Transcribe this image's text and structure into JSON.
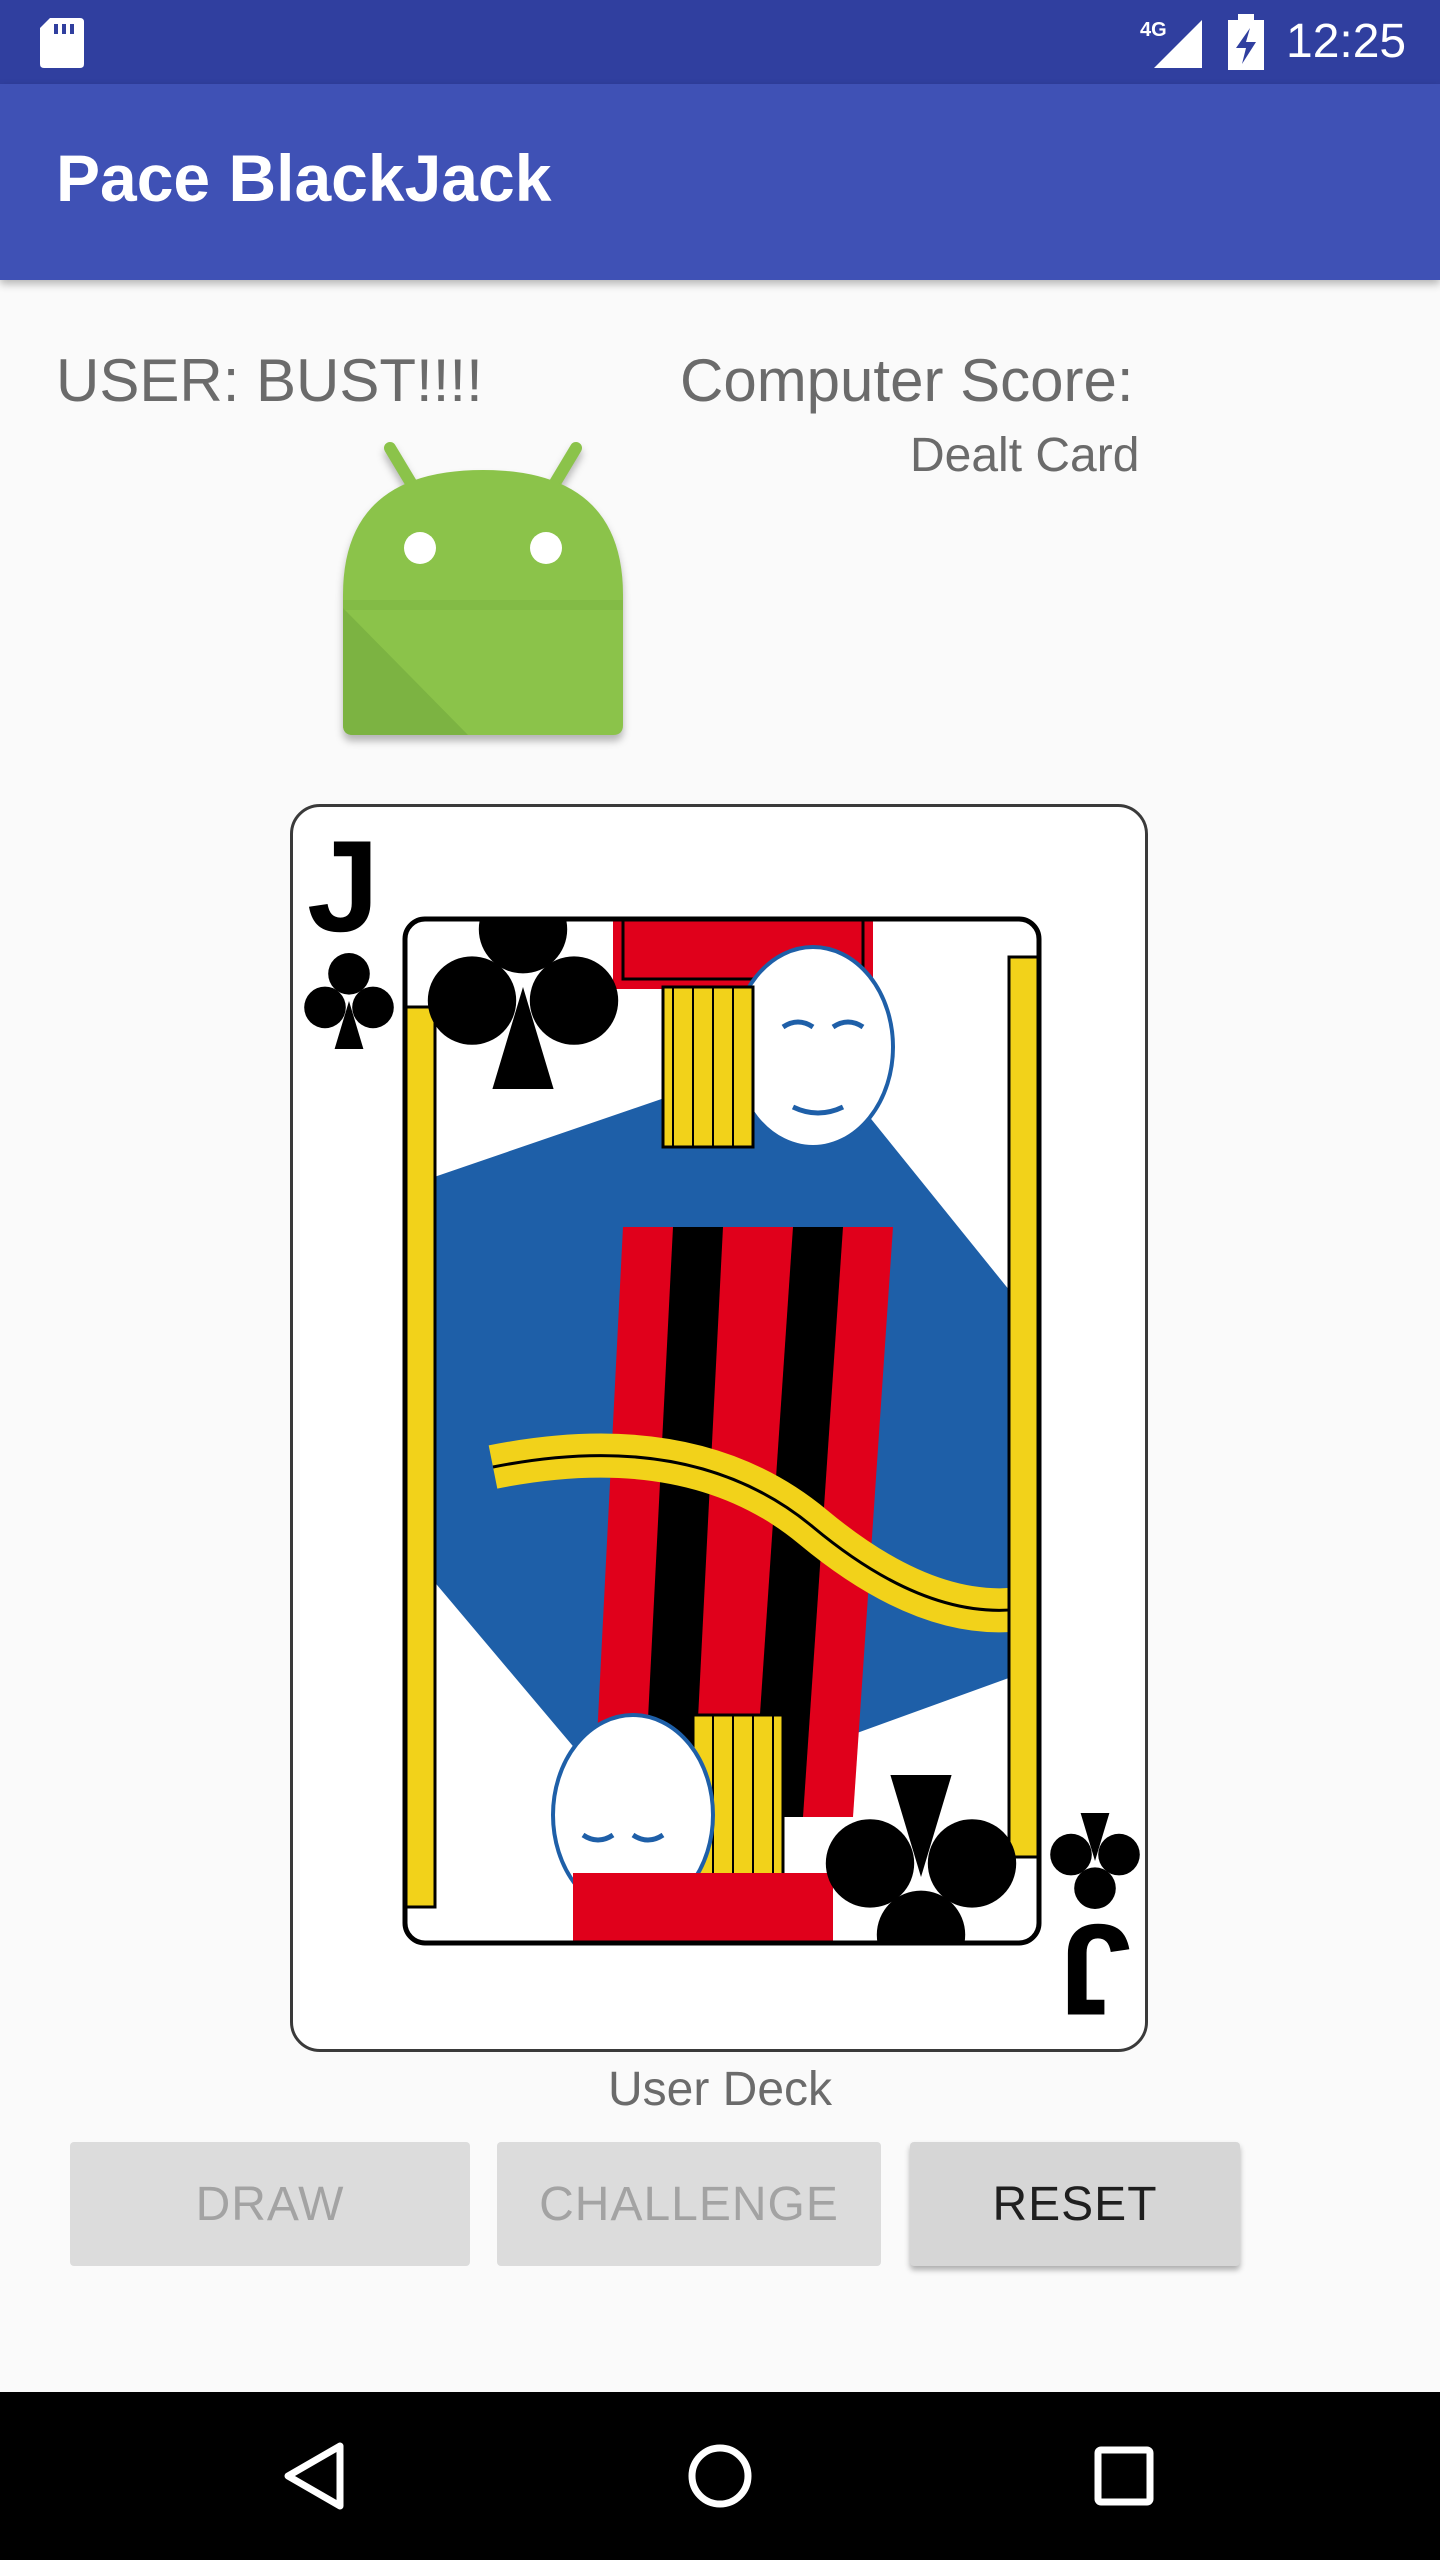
{
  "status_bar": {
    "time": "12:25",
    "network": "4G",
    "icons": [
      "sd-card-icon",
      "signal-icon",
      "battery-charging-icon"
    ]
  },
  "app_bar": {
    "title": "Pace BlackJack"
  },
  "game": {
    "user_status": "USER: BUST!!!!",
    "computer_score_label": "Computer Score:",
    "dealt_card_label": "Dealt Card",
    "dealt_card_image": "android-icon",
    "user_card": {
      "rank": "J",
      "suit": "clubs"
    },
    "user_deck_label": "User Deck"
  },
  "buttons": {
    "draw": {
      "label": "DRAW",
      "enabled": false
    },
    "challenge": {
      "label": "CHALLENGE",
      "enabled": false
    },
    "reset": {
      "label": "RESET",
      "enabled": true
    }
  },
  "nav_bar": {
    "icons": [
      "back-icon",
      "home-icon",
      "recents-icon"
    ]
  },
  "colors": {
    "status_bar": "#303f9f",
    "app_bar": "#3f51b5",
    "android_green": "#8bc34a",
    "card_red": "#e0001b",
    "card_blue": "#1e5fa8",
    "card_gold": "#f2d21a"
  }
}
